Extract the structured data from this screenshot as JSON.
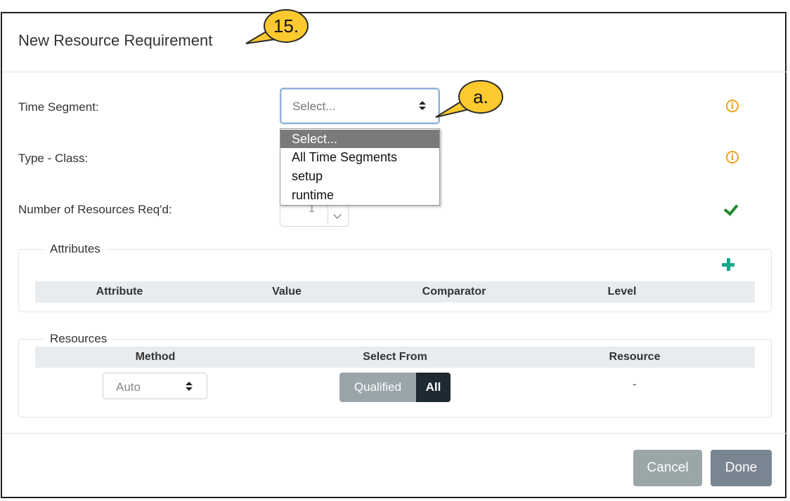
{
  "dialog": {
    "title": "New Resource Requirement"
  },
  "form": {
    "time_segment_label": "Time Segment:",
    "time_segment_value": "Select...",
    "time_segment_options": [
      "Select...",
      "All Time Segments",
      "setup",
      "runtime"
    ],
    "type_class_label": "Type - Class:",
    "num_resources_label": "Number of Resources Req'd:",
    "num_resources_value": "1"
  },
  "attributes": {
    "legend": "Attributes",
    "columns": [
      "Attribute",
      "Value",
      "Comparator",
      "Level"
    ]
  },
  "resources": {
    "legend": "Resources",
    "columns": [
      "Method",
      "Select From",
      "Resource"
    ],
    "method_value": "Auto",
    "select_from_options": [
      "Qualified",
      "All"
    ],
    "resource_value": "-"
  },
  "buttons": {
    "cancel": "Cancel",
    "done": "Done"
  },
  "annotations": {
    "step": "15.",
    "sub": "a."
  },
  "colors": {
    "info": "#f0a21c",
    "check": "#1f8a2b",
    "plus": "#19a88b",
    "callout": "#fcc92f",
    "cancel": "#9aa6a7",
    "done": "#7a8592",
    "segment_active": "#1e2a32"
  },
  "icons": [
    "info-icon",
    "check-icon",
    "plus-icon",
    "updown-icon",
    "chevron-down-icon"
  ]
}
